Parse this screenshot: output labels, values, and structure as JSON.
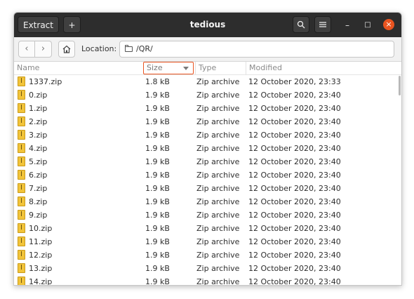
{
  "window": {
    "title": "tedious"
  },
  "header": {
    "extract_label": "Extract",
    "add_label": "+",
    "minimize": "–",
    "maximize": "□",
    "close": "×"
  },
  "toolbar": {
    "back": "‹",
    "forward": "›",
    "location_label": "Location:",
    "location_value": "/QR/"
  },
  "columns": {
    "name": "Name",
    "size": "Size",
    "type": "Type",
    "modified": "Modified"
  },
  "files": [
    {
      "name": "1337.zip",
      "size": "1.8 kB",
      "type": "Zip archive",
      "modified": "12 October 2020, 23:33"
    },
    {
      "name": "0.zip",
      "size": "1.9 kB",
      "type": "Zip archive",
      "modified": "12 October 2020, 23:40"
    },
    {
      "name": "1.zip",
      "size": "1.9 kB",
      "type": "Zip archive",
      "modified": "12 October 2020, 23:40"
    },
    {
      "name": "2.zip",
      "size": "1.9 kB",
      "type": "Zip archive",
      "modified": "12 October 2020, 23:40"
    },
    {
      "name": "3.zip",
      "size": "1.9 kB",
      "type": "Zip archive",
      "modified": "12 October 2020, 23:40"
    },
    {
      "name": "4.zip",
      "size": "1.9 kB",
      "type": "Zip archive",
      "modified": "12 October 2020, 23:40"
    },
    {
      "name": "5.zip",
      "size": "1.9 kB",
      "type": "Zip archive",
      "modified": "12 October 2020, 23:40"
    },
    {
      "name": "6.zip",
      "size": "1.9 kB",
      "type": "Zip archive",
      "modified": "12 October 2020, 23:40"
    },
    {
      "name": "7.zip",
      "size": "1.9 kB",
      "type": "Zip archive",
      "modified": "12 October 2020, 23:40"
    },
    {
      "name": "8.zip",
      "size": "1.9 kB",
      "type": "Zip archive",
      "modified": "12 October 2020, 23:40"
    },
    {
      "name": "9.zip",
      "size": "1.9 kB",
      "type": "Zip archive",
      "modified": "12 October 2020, 23:40"
    },
    {
      "name": "10.zip",
      "size": "1.9 kB",
      "type": "Zip archive",
      "modified": "12 October 2020, 23:40"
    },
    {
      "name": "11.zip",
      "size": "1.9 kB",
      "type": "Zip archive",
      "modified": "12 October 2020, 23:40"
    },
    {
      "name": "12.zip",
      "size": "1.9 kB",
      "type": "Zip archive",
      "modified": "12 October 2020, 23:40"
    },
    {
      "name": "13.zip",
      "size": "1.9 kB",
      "type": "Zip archive",
      "modified": "12 October 2020, 23:40"
    },
    {
      "name": "14.zip",
      "size": "1.9 kB",
      "type": "Zip archive",
      "modified": "12 October 2020, 23:40"
    }
  ]
}
